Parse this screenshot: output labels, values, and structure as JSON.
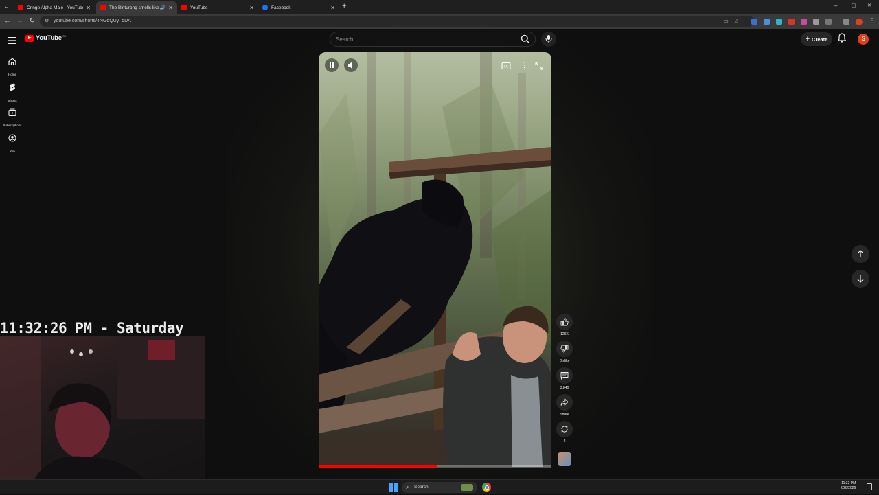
{
  "browser": {
    "tabs": [
      {
        "title": "Cringe Alpha Male - YouTube",
        "favicon_color": "#ff0000",
        "active": false
      },
      {
        "title": "The Binturong smells like P",
        "favicon_color": "#ff0000",
        "active": true
      },
      {
        "title": "YouTube",
        "favicon_color": "#ff0000",
        "active": false
      },
      {
        "title": "Facebook",
        "favicon_color": "#1877f2",
        "active": false
      }
    ],
    "new_tab_label": "+",
    "url": "youtube.com/shorts/4NGqQUy_dDA",
    "window_controls": {
      "minimize": "–",
      "maximize": "▢",
      "close": "✕"
    }
  },
  "youtube": {
    "logo_text": "YouTube",
    "logo_country": "SD",
    "search_placeholder": "Search",
    "create_label": "Create",
    "avatar_letter": "S",
    "sidebar": [
      {
        "label": "Home",
        "icon": "home-icon"
      },
      {
        "label": "Shorts",
        "icon": "shorts-icon"
      },
      {
        "label": "Subscriptions",
        "icon": "subscriptions-icon"
      },
      {
        "label": "You",
        "icon": "you-icon"
      }
    ],
    "actions": {
      "like_count": "126K",
      "dislike_label": "Dislike",
      "comments_count": "3,840",
      "share_label": "Share",
      "remix_count": "2"
    },
    "progress_fraction": 0.51
  },
  "overlay": {
    "clock_text": "11:32:26 PM - Saturday"
  },
  "taskbar": {
    "search_label": "Search",
    "time": "11:32 PM",
    "date": "2/28/2026"
  },
  "colors": {
    "accent": "#ff0000",
    "background": "#0f0f0f"
  }
}
